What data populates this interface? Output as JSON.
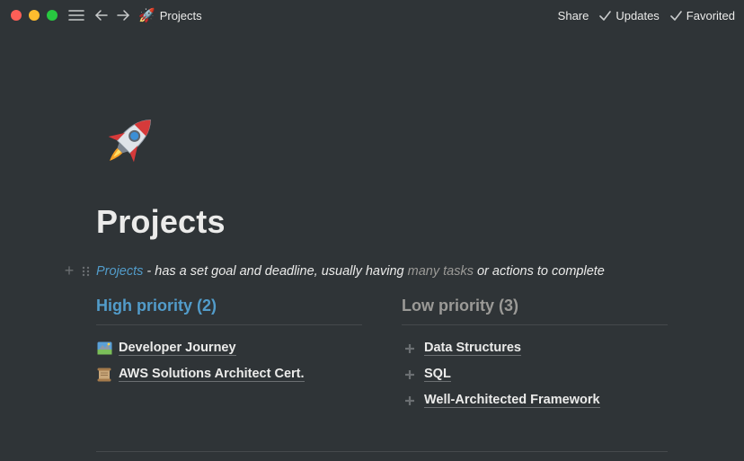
{
  "topbar": {
    "breadcrumb_emoji": "🚀",
    "breadcrumb_title": "Projects",
    "share_label": "Share",
    "updates_label": "Updates",
    "favorited_label": "Favorited"
  },
  "page": {
    "icon": "rocket-icon",
    "title": "Projects",
    "description": {
      "link": "Projects",
      "part1": " - has a set goal and deadline, usually having ",
      "muted": "many tasks",
      "part2": " or actions to complete"
    }
  },
  "columns": [
    {
      "heading": "High priority (2)",
      "items": [
        {
          "icon": "map-icon",
          "label": "Developer Journey"
        },
        {
          "icon": "scroll-icon",
          "label": "AWS Solutions Architect Cert."
        }
      ]
    },
    {
      "heading": "Low priority (3)",
      "items": [
        {
          "icon": "plus-icon",
          "label": "Data Structures"
        },
        {
          "icon": "plus-icon",
          "label": "SQL"
        },
        {
          "icon": "plus-icon",
          "label": "Well-Architected Framework"
        }
      ]
    }
  ],
  "colors": {
    "background": "#2f3437",
    "accent_blue": "#529cca",
    "muted_gray": "#9b9a97"
  }
}
